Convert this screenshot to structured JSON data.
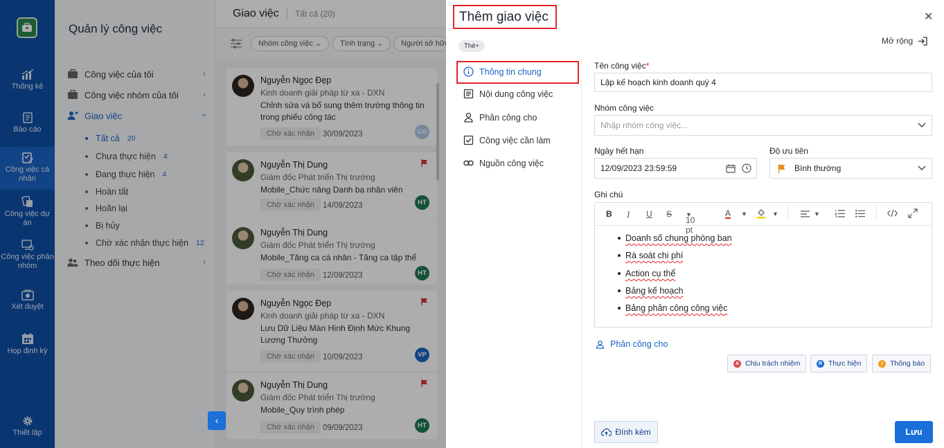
{
  "leftnav": {
    "items": [
      {
        "label": "Thống kê",
        "icon": "bar-chart-icon"
      },
      {
        "label": "Báo cáo",
        "icon": "report-icon"
      },
      {
        "label": "Công việc cá nhân",
        "icon": "personal-task-icon"
      },
      {
        "label": "Công việc dự án",
        "icon": "project-task-icon"
      },
      {
        "label": "Công việc phân nhóm",
        "icon": "group-task-icon"
      },
      {
        "label": "Xét duyệt",
        "icon": "approve-icon"
      },
      {
        "label": "Họp định kỳ",
        "icon": "calendar-icon"
      },
      {
        "label": "Thiết lập",
        "icon": "gear-icon"
      }
    ]
  },
  "sidebar": {
    "title": "Quản lý công việc",
    "items": [
      {
        "label": "Công việc của tôi"
      },
      {
        "label": "Công việc nhóm của tôi"
      },
      {
        "label": "Giao việc"
      },
      {
        "label": "Theo dõi thực hiện"
      }
    ],
    "subitems": [
      {
        "label": "Tất cả",
        "count": "20"
      },
      {
        "label": "Chưa thực hiện",
        "count": "4"
      },
      {
        "label": "Đang thực hiện",
        "count": "4"
      },
      {
        "label": "Hoàn tất",
        "count": ""
      },
      {
        "label": "Hoãn lại",
        "count": ""
      },
      {
        "label": "Bị hủy",
        "count": ""
      },
      {
        "label": "Chờ xác nhận thực hiện",
        "count": "12"
      }
    ]
  },
  "list": {
    "title": "Giao việc",
    "count_label": "Tất cả (20)",
    "filters": [
      "Nhóm công việc",
      "Tình trạng",
      "Người sở hữu"
    ],
    "cards": [
      {
        "name": "Nguyễn Ngọc Đẹp",
        "role": "Kinh doanh giải pháp từ xa - DXN",
        "desc": "Chỉnh sửa và bổ sung thêm trường thông tin trong phiếu công tác",
        "status": "Chờ xác nhận",
        "date": "30/09/2023",
        "initials": "CG",
        "flag": false
      },
      {
        "name": "Nguyễn Thị Dung",
        "role": "Giám đốc Phát triển Thị trường",
        "desc": "Mobile_Chức năng Danh bạ nhân viên",
        "status": "Chờ xác nhận",
        "date": "14/09/2023",
        "initials": "HT",
        "flag": true
      },
      {
        "name": "Nguyễn Thị Dung",
        "role": "Giám đốc Phát triển Thị trường",
        "desc": "Mobile_Tăng ca cá nhân - Tăng ca tập thể",
        "status": "Chờ xác nhận",
        "date": "12/09/2023",
        "initials": "HT",
        "flag": false
      },
      {
        "name": "Nguyễn Ngọc Đẹp",
        "role": "Kinh doanh giải pháp từ xa - DXN",
        "desc": "Lưu Dữ Liệu Màn Hình Định Mức Khung Lương Thưởng",
        "status": "Chờ xác nhận",
        "date": "10/09/2023",
        "initials": "VP",
        "flag": true
      },
      {
        "name": "Nguyễn Thị Dung",
        "role": "Giám đốc Phát triển Thị trường",
        "desc": "Mobile_Quy trình phép",
        "status": "Chờ xác nhận",
        "date": "09/09/2023",
        "initials": "HT",
        "flag": true
      }
    ]
  },
  "modal": {
    "title": "Thêm giao việc",
    "tag_chip": "Thẻ+",
    "expand_label": "Mở rộng",
    "nav": [
      {
        "label": "Thông tin chung",
        "icon": "info-icon"
      },
      {
        "label": "Nội dung công việc",
        "icon": "document-icon"
      },
      {
        "label": "Phân công cho",
        "icon": "person-icon"
      },
      {
        "label": "Công việc cần làm",
        "icon": "checkbox-icon"
      },
      {
        "label": "Nguồn công việc",
        "icon": "link-icon"
      }
    ],
    "fields": {
      "task_name_label": "Tên công việc",
      "task_name_required": "*",
      "task_name_value": "Lập kế hoạch kinh doanh quý 4",
      "group_label": "Nhóm công việc",
      "group_placeholder": "Nhập nhóm công việc...",
      "due_label": "Ngày hết hạn",
      "due_value": "12/09/2023 23:59:59",
      "priority_label": "Độ ưu tiên",
      "priority_value": "Bình thường",
      "note_label": "Ghi chú"
    },
    "editor": {
      "toolbar": {
        "bold": "B",
        "italic": "I",
        "underline": "U",
        "strike": "S",
        "font_size": "10 pt",
        "font_color": "A"
      },
      "bullets": [
        "Doanh số chung phòng ban",
        "Rà soát chi phí",
        "Action cụ thể",
        "Bảng kế hoạch",
        "Bảng phân công công việc"
      ]
    },
    "assign_label": "Phân công cho",
    "roles": [
      {
        "label": "Chịu trách nhiệm",
        "letter": "A",
        "color": "#e0454f"
      },
      {
        "label": "Thực hiện",
        "letter": "R",
        "color": "#1a6fd8"
      },
      {
        "label": "Thông báo",
        "letter": "I",
        "color": "#f0a01e"
      }
    ],
    "attach_label": "Đính kèm",
    "save_label": "Lưu"
  },
  "colors": {
    "primary": "#1a6fd8",
    "nav_bg": "#0e4fa7",
    "highlight_border": "#e3242b"
  }
}
